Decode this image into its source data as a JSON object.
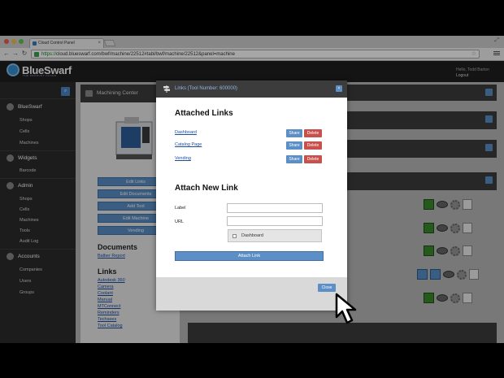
{
  "browser": {
    "tab_title": "Cloud Control Panel",
    "url_scheme": "https://",
    "url_rest": "cloud.blueswarf.com/bwf/machine/22512#tabl/bwf/machine/22512&panel=machine"
  },
  "header": {
    "logo_text": "BlueSwarf",
    "logo_sub": "THE PRODUCT CLOUD",
    "user_name": "Hello, Todd Barton",
    "logout": "Logout"
  },
  "sidebar": {
    "sections": [
      {
        "label": "BlueSwarf",
        "items": [
          "Shops",
          "Cells",
          "Machines"
        ]
      },
      {
        "label": "Widgets",
        "items": [
          "Barcode"
        ]
      },
      {
        "label": "Admin",
        "items": [
          "Shops",
          "Cells",
          "Machines",
          "Tools",
          "Audit Log"
        ]
      },
      {
        "label": "Accounts",
        "items": [
          "Companies",
          "Users",
          "Groups"
        ]
      }
    ]
  },
  "machining": {
    "title": "Machining Center",
    "actions": [
      "Edit Links",
      "Edit Documents",
      "Add Tool",
      "Edit Machine",
      "Vending"
    ],
    "documents_heading": "Documents",
    "documents": [
      "Balber Report"
    ],
    "links_heading": "Links",
    "links": [
      "Autodesk 360",
      "Camera",
      "Coolant",
      "Manual",
      "MTConnect",
      "Reminders",
      "Techsees",
      "Tool Catalog"
    ]
  },
  "modal": {
    "title": "Links (Tool Number: 600000)",
    "attached_heading": "Attached Links",
    "attached_links": [
      {
        "name": "Dashboard",
        "share": "Share",
        "delete": "Delete"
      },
      {
        "name": "Catalog Page",
        "share": "Share",
        "delete": "Delete"
      },
      {
        "name": "Vending",
        "share": "Share",
        "delete": "Delete"
      }
    ],
    "attach_heading": "Attach New Link",
    "label_field": "Label",
    "url_field": "URL",
    "selected_chip": "Dashboard",
    "attach_button": "Attach Link",
    "close_button": "Close"
  },
  "colors": {
    "accent": "#5b8fc6",
    "danger": "#c9514d",
    "dark": "#3c3c3c",
    "status_green": "#3b8a2b"
  }
}
